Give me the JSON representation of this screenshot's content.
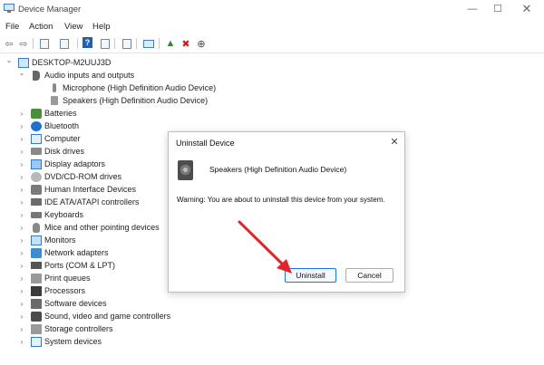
{
  "window": {
    "title": "Device Manager",
    "minimize": "—",
    "maximize": "☐",
    "close": "✕"
  },
  "menu": [
    "File",
    "Action",
    "View",
    "Help"
  ],
  "toolbar": [
    {
      "icon": "back-arrow-icon",
      "glyph": "⇦",
      "color": "#6b6b6b"
    },
    {
      "icon": "forward-arrow-icon",
      "glyph": "⇨",
      "color": "#6b6b6b"
    },
    {
      "icon": "properties-icon",
      "glyph": "",
      "color": "#6b86a6"
    },
    {
      "icon": "device-list-icon",
      "glyph": "",
      "color": "#6b86a6"
    },
    {
      "icon": "help-icon",
      "glyph": "?",
      "color": "#1f5fb4"
    },
    {
      "icon": "details-icon",
      "glyph": "",
      "color": "#6b86a6"
    },
    {
      "icon": "print-icon",
      "glyph": "",
      "color": "#6b86a6"
    },
    {
      "icon": "scan-hardware-icon",
      "glyph": "",
      "color": "#3f7fc4"
    },
    {
      "icon": "update-driver-icon",
      "glyph": "▲",
      "color": "#2e8b2e"
    },
    {
      "icon": "uninstall-x-icon",
      "glyph": "✖",
      "color": "#d11a1a"
    },
    {
      "icon": "download-icon",
      "glyph": "⊕",
      "color": "#444444"
    }
  ],
  "tree": [
    {
      "label": "DESKTOP-M2UUJ3D",
      "level": 0,
      "expanded": true,
      "icon": "computer-root-icon",
      "cls": "i-pc"
    },
    {
      "label": "Audio inputs and outputs",
      "level": 1,
      "expanded": true,
      "icon": "audio-icon",
      "cls": "i-audio"
    },
    {
      "label": "Microphone (High Definition Audio Device)",
      "level": 2,
      "icon": "microphone-icon",
      "cls": "i-mic"
    },
    {
      "label": "Speakers (High Definition Audio Device)",
      "level": 2,
      "icon": "speaker-icon",
      "cls": "i-spk"
    },
    {
      "label": "Batteries",
      "level": 1,
      "icon": "battery-icon",
      "cls": "i-bat"
    },
    {
      "label": "Bluetooth",
      "level": 1,
      "icon": "bluetooth-icon",
      "cls": "i-bt"
    },
    {
      "label": "Computer",
      "level": 1,
      "icon": "computer-icon",
      "cls": "i-comp"
    },
    {
      "label": "Disk drives",
      "level": 1,
      "icon": "disk-drive-icon",
      "cls": "i-disk"
    },
    {
      "label": "Display adaptors",
      "level": 1,
      "icon": "display-adapter-icon",
      "cls": "i-disp"
    },
    {
      "label": "DVD/CD-ROM drives",
      "level": 1,
      "icon": "dvd-drive-icon",
      "cls": "i-dvd"
    },
    {
      "label": "Human Interface Devices",
      "level": 1,
      "icon": "hid-icon",
      "cls": "i-hid"
    },
    {
      "label": "IDE ATA/ATAPI controllers",
      "level": 1,
      "icon": "ide-controller-icon",
      "cls": "i-ide"
    },
    {
      "label": "Keyboards",
      "level": 1,
      "icon": "keyboard-icon",
      "cls": "i-kbd"
    },
    {
      "label": "Mice and other pointing devices",
      "level": 1,
      "icon": "mouse-icon",
      "cls": "i-mouse"
    },
    {
      "label": "Monitors",
      "level": 1,
      "icon": "monitor-icon",
      "cls": "i-mon"
    },
    {
      "label": "Network adapters",
      "level": 1,
      "icon": "network-adapter-icon",
      "cls": "i-net"
    },
    {
      "label": "Ports (COM & LPT)",
      "level": 1,
      "icon": "port-icon",
      "cls": "i-port"
    },
    {
      "label": "Print queues",
      "level": 1,
      "icon": "printer-icon",
      "cls": "i-print"
    },
    {
      "label": "Processors",
      "level": 1,
      "icon": "processor-icon",
      "cls": "i-proc"
    },
    {
      "label": "Software devices",
      "level": 1,
      "icon": "software-device-icon",
      "cls": "i-soft"
    },
    {
      "label": "Sound, video and game controllers",
      "level": 1,
      "icon": "sound-controller-icon",
      "cls": "i-sound"
    },
    {
      "label": "Storage controllers",
      "level": 1,
      "icon": "storage-controller-icon",
      "cls": "i-stor"
    },
    {
      "label": "System devices",
      "level": 1,
      "icon": "system-device-icon",
      "cls": "i-sys"
    }
  ],
  "dialog": {
    "title": "Uninstall Device",
    "close": "✕",
    "device_name": "Speakers (High Definition Audio Device)",
    "warning": "Warning: You are about to uninstall this device from your system.",
    "uninstall_label": "Uninstall",
    "cancel_label": "Cancel"
  },
  "annotation": {
    "arrow_color": "#e0252b"
  }
}
